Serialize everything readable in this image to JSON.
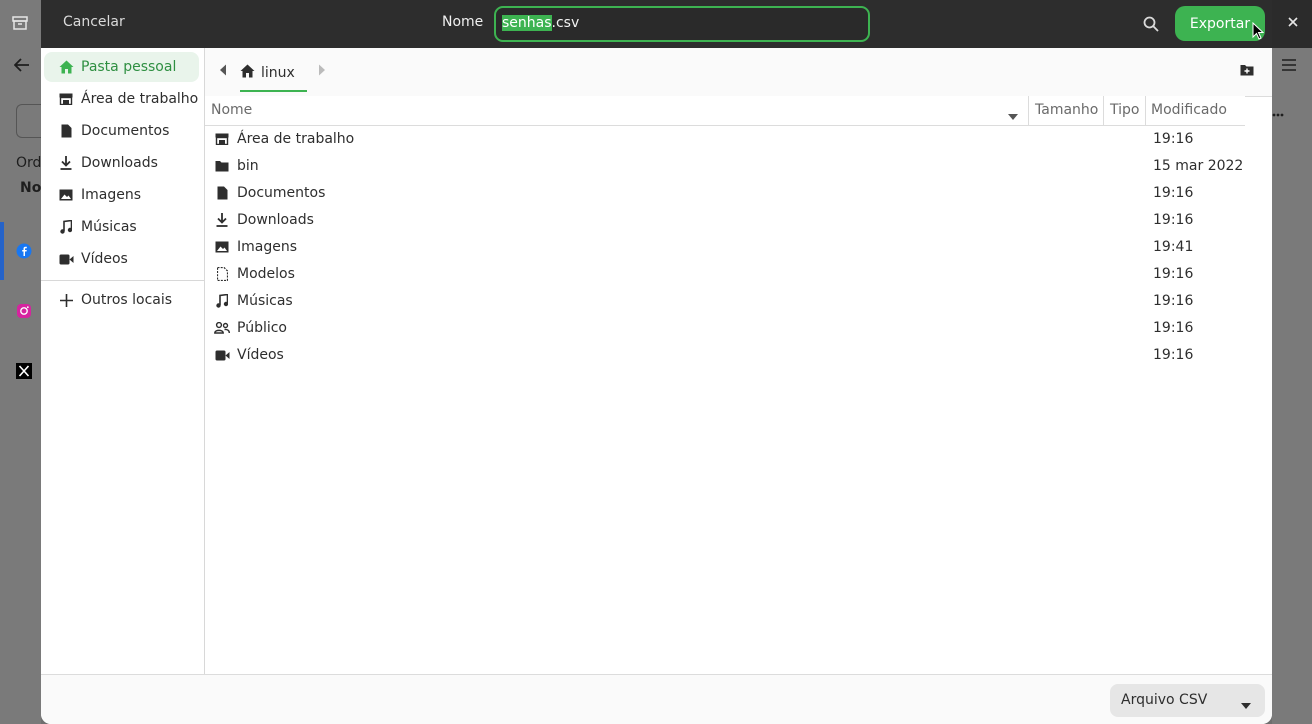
{
  "background": {
    "partial_labels": [
      "Orde",
      "Non"
    ]
  },
  "header": {
    "cancel_label": "Cancelar",
    "name_label": "Nome",
    "filename_selected": "senhas",
    "filename_rest": ".csv",
    "export_label": "Exportar"
  },
  "sidebar": {
    "items": [
      {
        "label": "Pasta pessoal",
        "icon": "home-icon"
      },
      {
        "label": "Área de trabalho",
        "icon": "desktop-icon"
      },
      {
        "label": "Documentos",
        "icon": "document-icon"
      },
      {
        "label": "Downloads",
        "icon": "download-icon"
      },
      {
        "label": "Imagens",
        "icon": "image-icon"
      },
      {
        "label": "Músicas",
        "icon": "music-icon"
      },
      {
        "label": "Vídeos",
        "icon": "video-icon"
      }
    ],
    "other_locations_label": "Outros locais"
  },
  "pathbar": {
    "crumb_label": "linux"
  },
  "list": {
    "columns": [
      "Nome",
      "Tamanho",
      "Tipo",
      "Modificado"
    ],
    "rows": [
      {
        "name": "Área de trabalho",
        "modified": "19:16",
        "icon": "desktop-icon"
      },
      {
        "name": "bin",
        "modified": "15 mar 2022",
        "icon": "folder-icon"
      },
      {
        "name": "Documentos",
        "modified": "19:16",
        "icon": "document-icon"
      },
      {
        "name": "Downloads",
        "modified": "19:16",
        "icon": "download-icon"
      },
      {
        "name": "Imagens",
        "modified": "19:41",
        "icon": "image-icon"
      },
      {
        "name": "Modelos",
        "modified": "19:16",
        "icon": "template-icon"
      },
      {
        "name": "Músicas",
        "modified": "19:16",
        "icon": "music-icon"
      },
      {
        "name": "Público",
        "modified": "19:16",
        "icon": "public-icon"
      },
      {
        "name": "Vídeos",
        "modified": "19:16",
        "icon": "video-icon"
      }
    ]
  },
  "footer": {
    "filter_label": "Arquivo CSV"
  },
  "colors": {
    "accent": "#3db351",
    "header_bg": "#2d2d2d"
  }
}
